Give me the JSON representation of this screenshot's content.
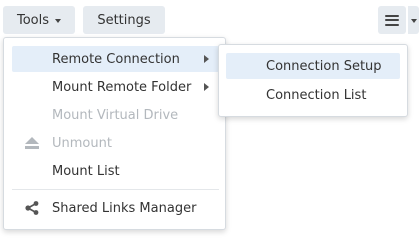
{
  "toolbar": {
    "tools_label": "Tools",
    "settings_label": "Settings"
  },
  "tools_menu": {
    "items": [
      {
        "label": "Remote Connection",
        "state": "active",
        "has_submenu": true
      },
      {
        "label": "Mount Remote Folder",
        "state": "normal",
        "has_submenu": true
      },
      {
        "label": "Mount Virtual Drive",
        "state": "disabled",
        "has_submenu": false
      },
      {
        "label": "Unmount",
        "state": "disabled",
        "has_submenu": false,
        "icon": "eject-icon"
      },
      {
        "label": "Mount List",
        "state": "normal",
        "has_submenu": false
      },
      {
        "label": "Shared Links Manager",
        "state": "normal",
        "has_submenu": false,
        "icon": "share-icon"
      }
    ]
  },
  "remote_connection_submenu": {
    "items": [
      {
        "label": "Connection Setup",
        "state": "hover"
      },
      {
        "label": "Connection List",
        "state": "normal"
      }
    ]
  },
  "colors": {
    "button_bg": "#e6ebf0",
    "highlight_bg": "#e4eef9",
    "disabled_text": "#b3b8bd"
  }
}
